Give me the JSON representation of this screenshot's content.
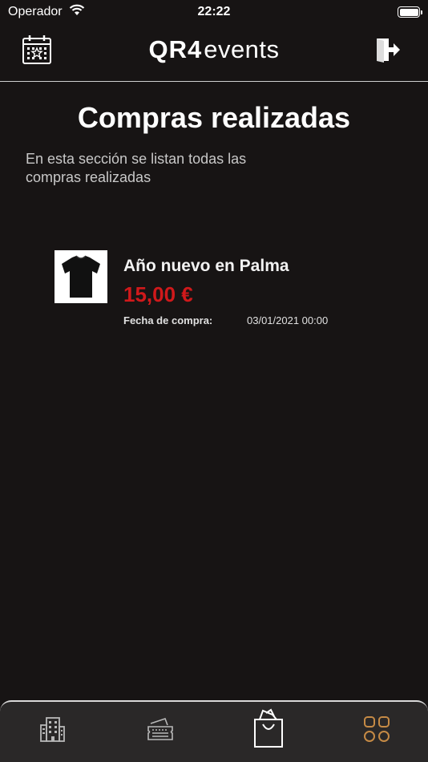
{
  "status_bar": {
    "carrier": "Operador",
    "time": "22:22",
    "battery_level": 1.0
  },
  "header": {
    "logo_bold": "QR4",
    "logo_light": "events",
    "left_icon": "calendar-icon",
    "right_icon": "logout-icon"
  },
  "page": {
    "title": "Compras realizadas",
    "description": "En esta sección se listan todas las compras realizadas"
  },
  "purchases": [
    {
      "title": "Año nuevo en Palma",
      "price": "15,00 €",
      "date_label": "Fecha de compra:",
      "date_value": "03/01/2021 00:00",
      "thumbnail": "tshirt-image"
    }
  ],
  "tab_bar": {
    "tabs": [
      {
        "icon": "building-icon",
        "active": false
      },
      {
        "icon": "ticket-icon",
        "active": false
      },
      {
        "icon": "shopping-bag-icon",
        "active": true
      },
      {
        "icon": "grid-icon",
        "active": false
      }
    ]
  },
  "colors": {
    "background": "#171414",
    "price": "#d0191b",
    "tab_accent": "#c58a45",
    "tab_icon": "#b8b8b8"
  }
}
